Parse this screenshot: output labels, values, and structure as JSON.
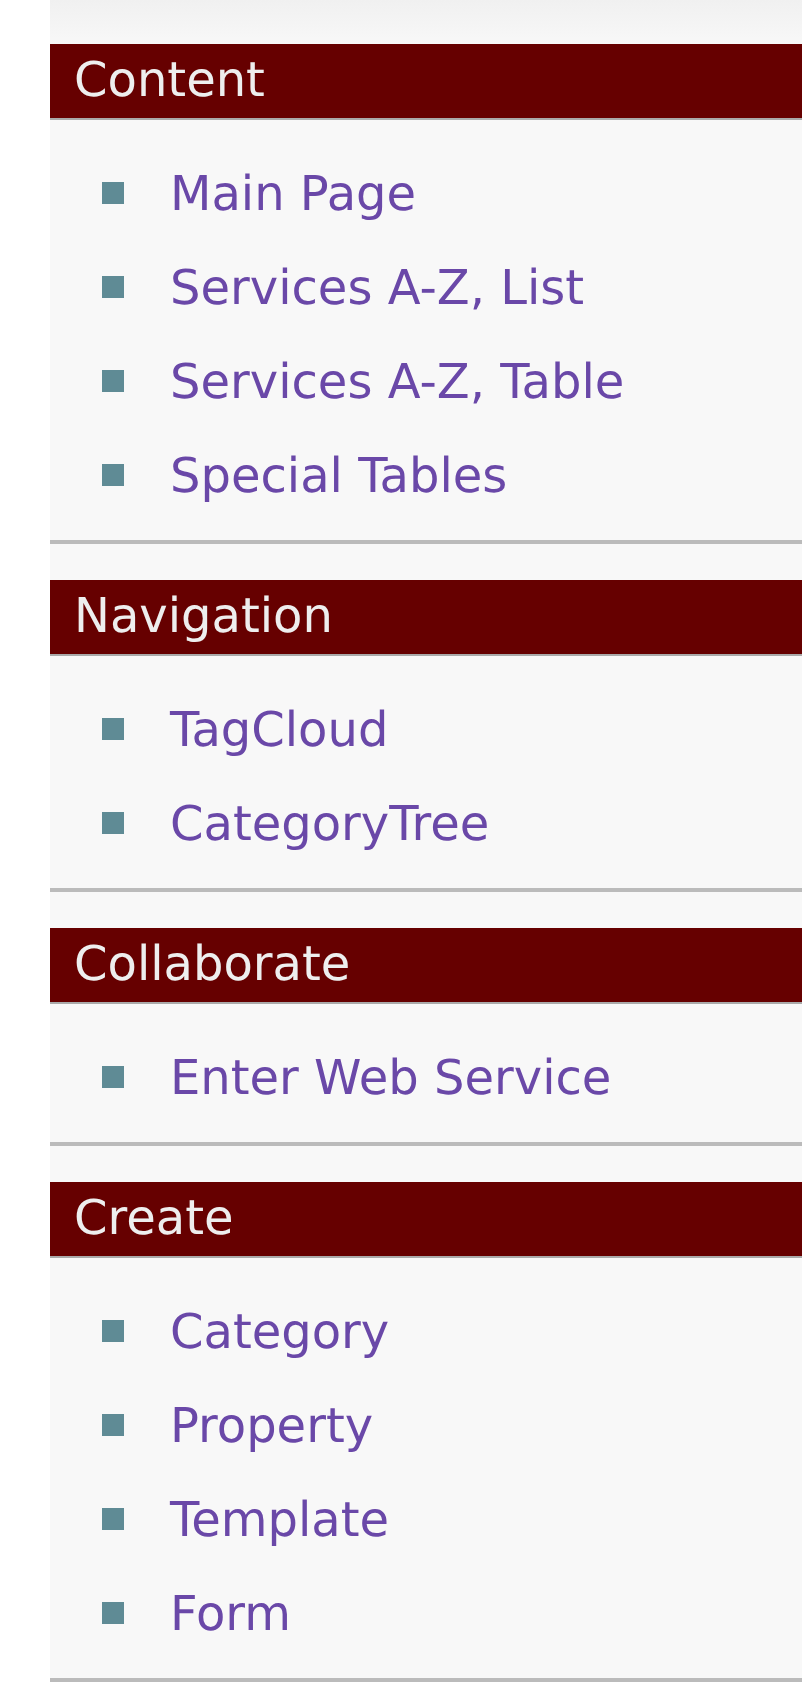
{
  "sections": [
    {
      "title": "Content",
      "items": [
        "Main Page",
        "Services A-Z, List",
        "Services A-Z, Table",
        "Special Tables"
      ]
    },
    {
      "title": "Navigation",
      "items": [
        "TagCloud",
        "CategoryTree"
      ]
    },
    {
      "title": "Collaborate",
      "items": [
        "Enter Web Service"
      ]
    },
    {
      "title": "Create",
      "items": [
        "Category",
        "Property",
        "Template",
        "Form"
      ]
    }
  ]
}
